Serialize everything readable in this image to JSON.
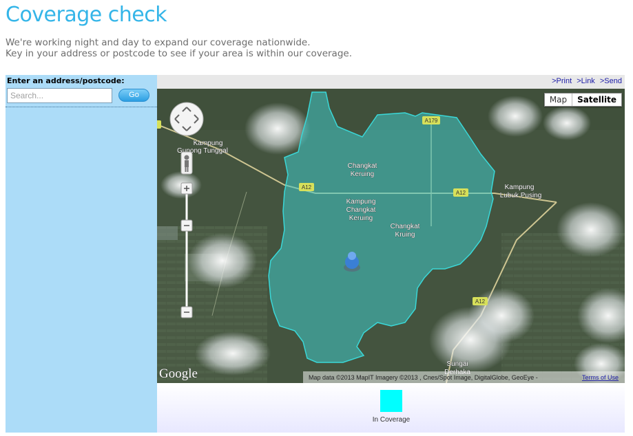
{
  "page": {
    "title": "Coverage check",
    "intro_line1": "We're working night and day to expand our coverage nationwide.",
    "intro_line2": "Key in your address or postcode to see if your area is within our coverage."
  },
  "search": {
    "label": "Enter an address/postcode:",
    "placeholder": "Search...",
    "value": "",
    "go_label": "Go"
  },
  "map": {
    "links": [
      ">Print",
      ">Link",
      ">Send"
    ],
    "type_map": "Map",
    "type_satellite": "Satellite",
    "active_type": "Satellite",
    "place_labels": [
      "Kampung",
      "Gunong Tunggal",
      "Changkat",
      "Keruing",
      "Kampung",
      "Changkat",
      "Keruing",
      "Changkat",
      "Kruing",
      "Kampung",
      "Lubuk Pusing",
      "Sungai",
      "Derhaka"
    ],
    "road_labels": [
      "A12",
      "A12",
      "A179",
      "A12"
    ],
    "google_logo": "Google",
    "attribution": "Map data ©2013 MapIT Imagery ©2013 , Cnes/Spot Image, DigitalGlobe, GeoEye -",
    "terms": "Terms of Use",
    "coverage_color": "#40c8c8"
  },
  "legend": {
    "label": "In Coverage",
    "color": "#00ffff"
  }
}
